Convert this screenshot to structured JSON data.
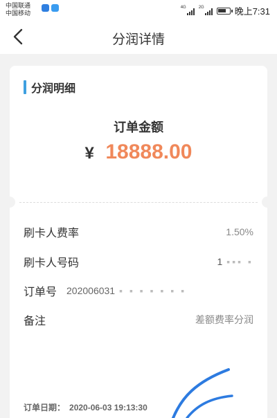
{
  "status_bar": {
    "carrier_1": "中国联通",
    "carrier_2": "中国移动",
    "signal_1_label": "4G",
    "signal_2_label": "2G",
    "time": "晚上7:31"
  },
  "nav": {
    "title": "分润详情"
  },
  "card": {
    "section_title": "分润明细",
    "amount_label": "订单金额",
    "currency": "¥",
    "amount_value": "18888.00",
    "rows": [
      {
        "label": "刷卡人费率",
        "value": "1.50%"
      },
      {
        "label": "刷卡人号码",
        "value": "1"
      },
      {
        "label": "订单号",
        "value": "202006031"
      },
      {
        "label": "备注",
        "value": "差额费率分润"
      }
    ],
    "order_date_label": "订单日期：",
    "order_date_value": "2020-06-03 19:13:30"
  },
  "colors": {
    "accent_bar": "#3fa0e0",
    "amount": "#f0885a",
    "scribble": "#2d7be0"
  }
}
